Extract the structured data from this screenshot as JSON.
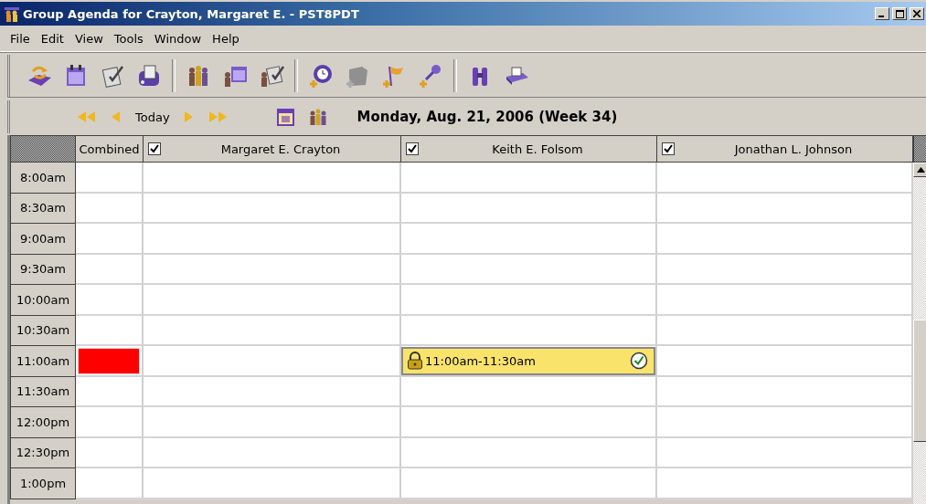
{
  "window": {
    "title": "Group Agenda for Crayton, Margaret E. - PST8PDT"
  },
  "menu": [
    "File",
    "Edit",
    "View",
    "Tools",
    "Window",
    "Help"
  ],
  "nav": {
    "today": "Today",
    "date": "Monday, Aug. 21, 2006  (Week 34)"
  },
  "grid": {
    "combined_label": "Combined",
    "people": [
      {
        "name": "Margaret E. Crayton",
        "checked": true
      },
      {
        "name": "Keith E. Folsom",
        "checked": true
      },
      {
        "name": "Jonathan L. Johnson",
        "checked": true
      }
    ],
    "rows": [
      {
        "time": "8:00am",
        "busy": false
      },
      {
        "time": "8:30am",
        "busy": false
      },
      {
        "time": "9:00am",
        "busy": false
      },
      {
        "time": "9:30am",
        "busy": false
      },
      {
        "time": "10:00am",
        "busy": false
      },
      {
        "time": "10:30am",
        "busy": false
      },
      {
        "time": "11:00am",
        "busy": true,
        "cells": [
          null,
          {
            "label": "11:00am-11:30am",
            "locked": true,
            "accepted": true
          },
          null
        ]
      },
      {
        "time": "11:30am",
        "busy": false
      },
      {
        "time": "12:00pm",
        "busy": false
      },
      {
        "time": "12:30pm",
        "busy": false
      },
      {
        "time": "1:00pm",
        "busy": false
      }
    ]
  }
}
